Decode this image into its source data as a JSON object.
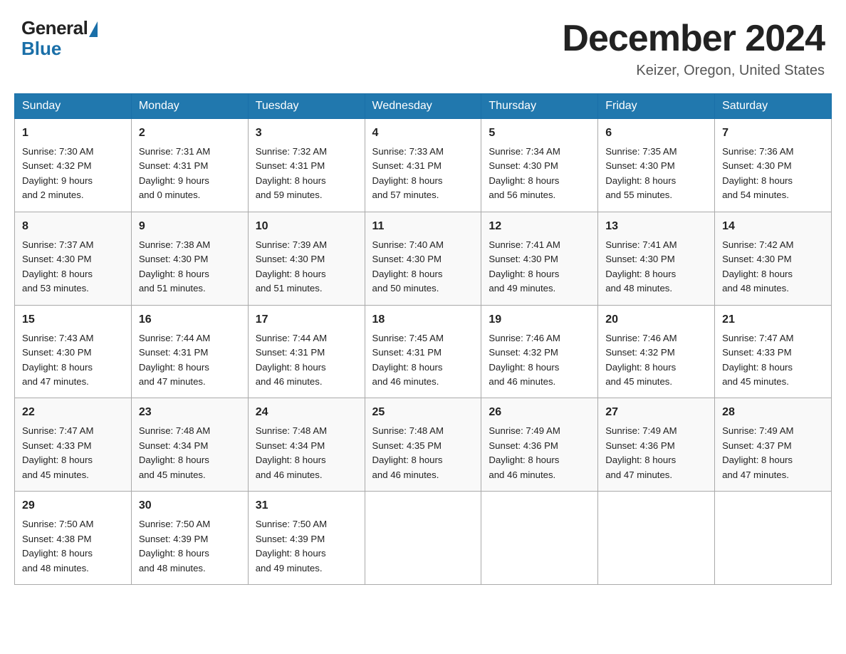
{
  "header": {
    "logo_general": "General",
    "logo_blue": "Blue",
    "month_title": "December 2024",
    "location": "Keizer, Oregon, United States"
  },
  "calendar": {
    "days_of_week": [
      "Sunday",
      "Monday",
      "Tuesday",
      "Wednesday",
      "Thursday",
      "Friday",
      "Saturday"
    ],
    "weeks": [
      [
        {
          "day": "1",
          "sunrise": "7:30 AM",
          "sunset": "4:32 PM",
          "daylight": "9 hours and 2 minutes."
        },
        {
          "day": "2",
          "sunrise": "7:31 AM",
          "sunset": "4:31 PM",
          "daylight": "9 hours and 0 minutes."
        },
        {
          "day": "3",
          "sunrise": "7:32 AM",
          "sunset": "4:31 PM",
          "daylight": "8 hours and 59 minutes."
        },
        {
          "day": "4",
          "sunrise": "7:33 AM",
          "sunset": "4:31 PM",
          "daylight": "8 hours and 57 minutes."
        },
        {
          "day": "5",
          "sunrise": "7:34 AM",
          "sunset": "4:30 PM",
          "daylight": "8 hours and 56 minutes."
        },
        {
          "day": "6",
          "sunrise": "7:35 AM",
          "sunset": "4:30 PM",
          "daylight": "8 hours and 55 minutes."
        },
        {
          "day": "7",
          "sunrise": "7:36 AM",
          "sunset": "4:30 PM",
          "daylight": "8 hours and 54 minutes."
        }
      ],
      [
        {
          "day": "8",
          "sunrise": "7:37 AM",
          "sunset": "4:30 PM",
          "daylight": "8 hours and 53 minutes."
        },
        {
          "day": "9",
          "sunrise": "7:38 AM",
          "sunset": "4:30 PM",
          "daylight": "8 hours and 51 minutes."
        },
        {
          "day": "10",
          "sunrise": "7:39 AM",
          "sunset": "4:30 PM",
          "daylight": "8 hours and 51 minutes."
        },
        {
          "day": "11",
          "sunrise": "7:40 AM",
          "sunset": "4:30 PM",
          "daylight": "8 hours and 50 minutes."
        },
        {
          "day": "12",
          "sunrise": "7:41 AM",
          "sunset": "4:30 PM",
          "daylight": "8 hours and 49 minutes."
        },
        {
          "day": "13",
          "sunrise": "7:41 AM",
          "sunset": "4:30 PM",
          "daylight": "8 hours and 48 minutes."
        },
        {
          "day": "14",
          "sunrise": "7:42 AM",
          "sunset": "4:30 PM",
          "daylight": "8 hours and 48 minutes."
        }
      ],
      [
        {
          "day": "15",
          "sunrise": "7:43 AM",
          "sunset": "4:30 PM",
          "daylight": "8 hours and 47 minutes."
        },
        {
          "day": "16",
          "sunrise": "7:44 AM",
          "sunset": "4:31 PM",
          "daylight": "8 hours and 47 minutes."
        },
        {
          "day": "17",
          "sunrise": "7:44 AM",
          "sunset": "4:31 PM",
          "daylight": "8 hours and 46 minutes."
        },
        {
          "day": "18",
          "sunrise": "7:45 AM",
          "sunset": "4:31 PM",
          "daylight": "8 hours and 46 minutes."
        },
        {
          "day": "19",
          "sunrise": "7:46 AM",
          "sunset": "4:32 PM",
          "daylight": "8 hours and 46 minutes."
        },
        {
          "day": "20",
          "sunrise": "7:46 AM",
          "sunset": "4:32 PM",
          "daylight": "8 hours and 45 minutes."
        },
        {
          "day": "21",
          "sunrise": "7:47 AM",
          "sunset": "4:33 PM",
          "daylight": "8 hours and 45 minutes."
        }
      ],
      [
        {
          "day": "22",
          "sunrise": "7:47 AM",
          "sunset": "4:33 PM",
          "daylight": "8 hours and 45 minutes."
        },
        {
          "day": "23",
          "sunrise": "7:48 AM",
          "sunset": "4:34 PM",
          "daylight": "8 hours and 45 minutes."
        },
        {
          "day": "24",
          "sunrise": "7:48 AM",
          "sunset": "4:34 PM",
          "daylight": "8 hours and 46 minutes."
        },
        {
          "day": "25",
          "sunrise": "7:48 AM",
          "sunset": "4:35 PM",
          "daylight": "8 hours and 46 minutes."
        },
        {
          "day": "26",
          "sunrise": "7:49 AM",
          "sunset": "4:36 PM",
          "daylight": "8 hours and 46 minutes."
        },
        {
          "day": "27",
          "sunrise": "7:49 AM",
          "sunset": "4:36 PM",
          "daylight": "8 hours and 47 minutes."
        },
        {
          "day": "28",
          "sunrise": "7:49 AM",
          "sunset": "4:37 PM",
          "daylight": "8 hours and 47 minutes."
        }
      ],
      [
        {
          "day": "29",
          "sunrise": "7:50 AM",
          "sunset": "4:38 PM",
          "daylight": "8 hours and 48 minutes."
        },
        {
          "day": "30",
          "sunrise": "7:50 AM",
          "sunset": "4:39 PM",
          "daylight": "8 hours and 48 minutes."
        },
        {
          "day": "31",
          "sunrise": "7:50 AM",
          "sunset": "4:39 PM",
          "daylight": "8 hours and 49 minutes."
        },
        null,
        null,
        null,
        null
      ]
    ],
    "labels": {
      "sunrise": "Sunrise:",
      "sunset": "Sunset:",
      "daylight": "Daylight:"
    }
  }
}
